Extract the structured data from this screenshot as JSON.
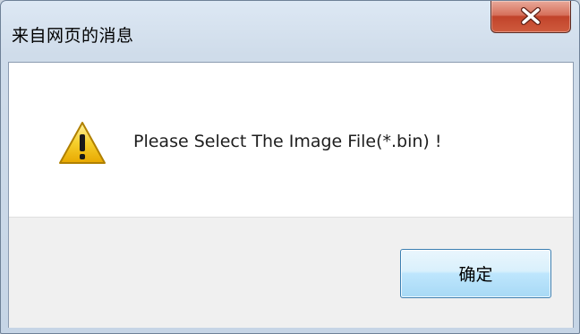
{
  "window": {
    "title": "来自网页的消息"
  },
  "titlebar": {
    "close_icon": "close-icon",
    "close_color": "#c1432a"
  },
  "dialog": {
    "icon": "warning-icon",
    "icon_color": "#f2c200",
    "message": "Please Select The Image File(*.bin) !"
  },
  "buttons": {
    "ok_label": "确定"
  }
}
